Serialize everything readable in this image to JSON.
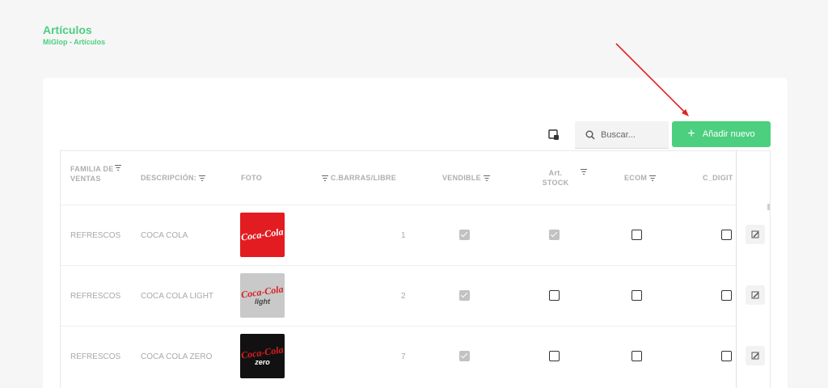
{
  "header": {
    "title": "Artículos",
    "breadcrumb": "MiGlop - Artículos"
  },
  "toolbar": {
    "search_placeholder": "Buscar...",
    "add_label": "Añadir nuevo",
    "column_toggle_icon": "columns-icon",
    "search_icon": "search-icon"
  },
  "table": {
    "columns": [
      "FAMILIA DE VENTAS",
      "DESCRIPCIÓN:",
      "FOTO",
      "C.BARRAS/LIBRE",
      "VENDIBLE",
      "Art. STOCK",
      "ECOM",
      "C_DIGIT"
    ],
    "rows": [
      {
        "familia": "REFRESCOS",
        "descripcion": "COCA COLA",
        "foto_logo": "Coca-Cola",
        "foto_sub": "",
        "codigo": "1",
        "vendible": true,
        "stock": true,
        "ecom": false,
        "cdigit": false
      },
      {
        "familia": "REFRESCOS",
        "descripcion": "COCA COLA LIGHT",
        "foto_logo": "Coca-Cola",
        "foto_sub": "light",
        "codigo": "2",
        "vendible": true,
        "stock": false,
        "ecom": false,
        "cdigit": false
      },
      {
        "familia": "REFRESCOS",
        "descripcion": "COCA COLA ZERO",
        "foto_logo": "Coca-Cola",
        "foto_sub": "zero",
        "codigo": "7",
        "vendible": true,
        "stock": false,
        "ecom": false,
        "cdigit": false
      }
    ]
  },
  "colors": {
    "accent": "#4ccf7f",
    "annotation_arrow": "#e02020"
  }
}
